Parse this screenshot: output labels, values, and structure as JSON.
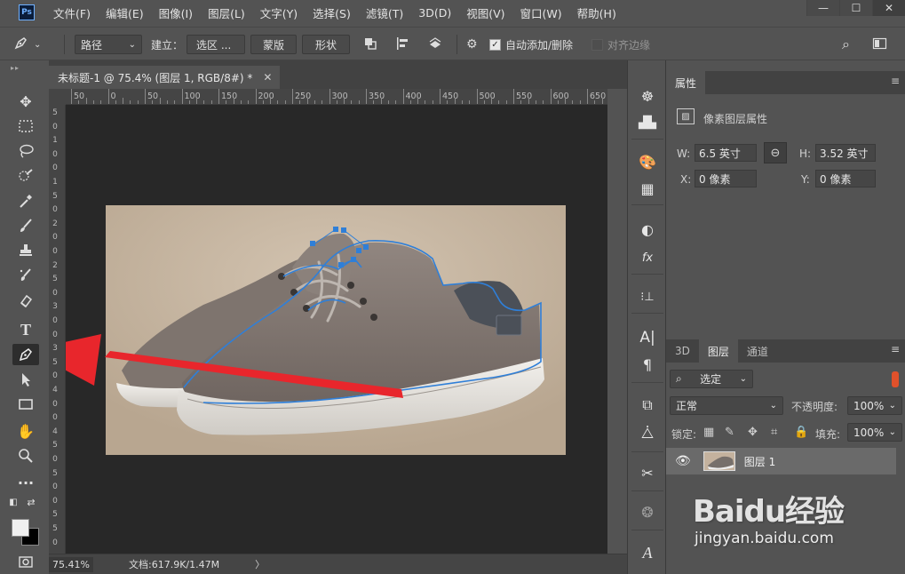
{
  "app": {
    "logo": "Ps"
  },
  "menu": [
    "文件(F)",
    "编辑(E)",
    "图像(I)",
    "图层(L)",
    "文字(Y)",
    "选择(S)",
    "滤镜(T)",
    "3D(D)",
    "视图(V)",
    "窗口(W)",
    "帮助(H)"
  ],
  "window_controls": {
    "minimize": "—",
    "maximize": "☐",
    "close": "✕"
  },
  "options_bar": {
    "mode_select": "路径",
    "build_label": "建立：",
    "selection_button": "选区 ...",
    "mask_button": "蒙版",
    "shape_button": "形状",
    "auto_add_delete": "自动添加/删除",
    "auto_add_delete_checked": true,
    "align_edges": "对齐边缘",
    "align_edges_checked": false
  },
  "document": {
    "tab_title": "未标题-1 @ 75.4% (图层 1, RGB/8#) *",
    "tab_close": "✕",
    "ruler_h": [
      "50",
      "0",
      "50",
      "100",
      "150",
      "200",
      "250",
      "300",
      "350",
      "400",
      "450",
      "500",
      "550",
      "600",
      "650"
    ],
    "ruler_v": [
      "5",
      "0",
      "1",
      "0",
      "0",
      "1",
      "5",
      "0",
      "2",
      "0",
      "0",
      "2",
      "5",
      "0",
      "3",
      "0",
      "0",
      "3",
      "5",
      "0",
      "4",
      "0",
      "0",
      "4",
      "5",
      "0",
      "5",
      "0",
      "0",
      "5",
      "5",
      "0"
    ]
  },
  "status": {
    "zoom": "75.41%",
    "doc_size": "文档:617.9K/1.47M",
    "arrow": "〉"
  },
  "properties": {
    "tab": "属性",
    "section_title": "像素图层属性",
    "w_label": "W:",
    "w_value": "6.5 英寸",
    "h_label": "H:",
    "h_value": "3.52 英寸",
    "x_label": "X:",
    "x_value": "0 像素",
    "y_label": "Y:",
    "y_value": "0 像素"
  },
  "layers": {
    "tabs": [
      "3D",
      "图层",
      "通道"
    ],
    "active_tab": "图层",
    "filter": "选定",
    "blend_mode": "正常",
    "opacity_label": "不透明度:",
    "opacity_value": "100%",
    "lock_label": "锁定:",
    "fill_label": "填充:",
    "fill_value": "100%",
    "layer_name": "图层 1"
  },
  "watermark": {
    "main": "Baidu经验",
    "sub": "jingyan.baidu.com"
  },
  "colors": {
    "app_bg": "#535353",
    "canvas_bg": "#282828",
    "arrow": "#e8262c",
    "path": "#2f7fd8"
  }
}
